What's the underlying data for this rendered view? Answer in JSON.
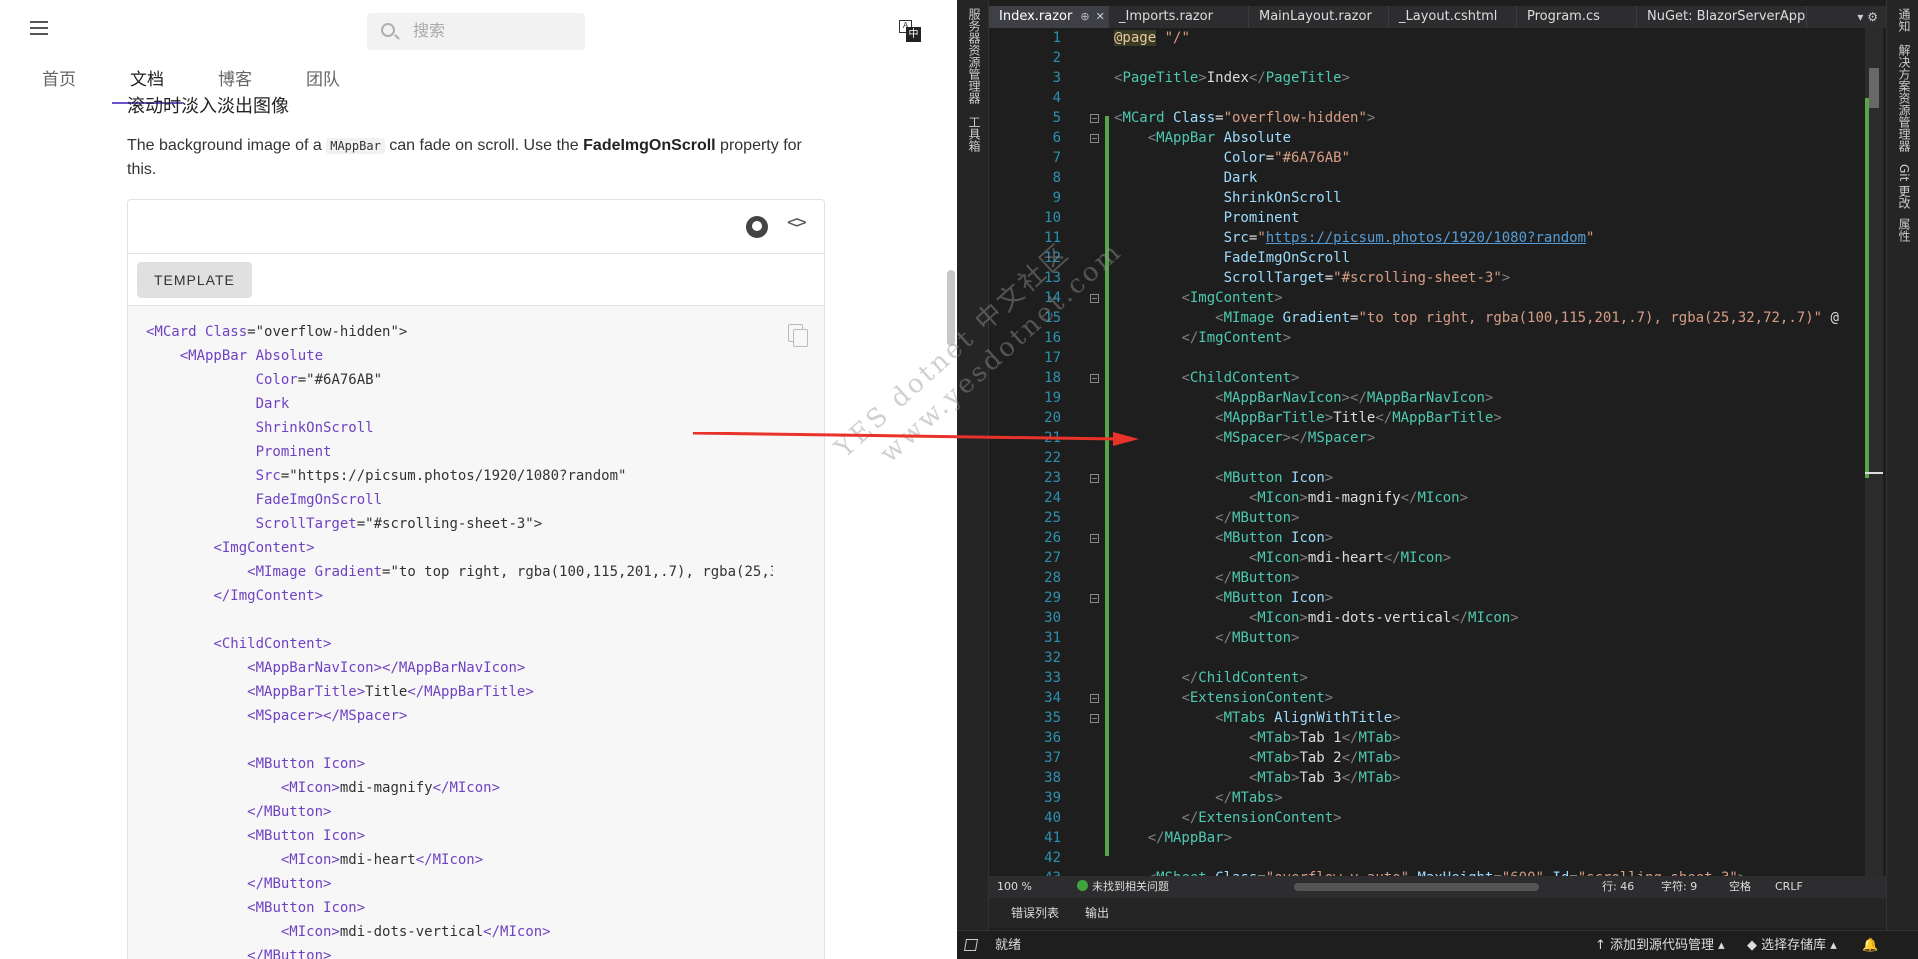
{
  "web": {
    "search_placeholder": "搜索",
    "translate_a": "A",
    "translate_zh": "中",
    "nav": [
      "首页",
      "文档",
      "博客",
      "团队"
    ],
    "section_title": "滚动时淡入淡出图像",
    "desc_pre": "The background image of a ",
    "desc_code": "MAppBar",
    "desc_mid": " can fade on scroll. Use the ",
    "desc_bold": "FadeImgOnScroll",
    "desc_post": " property for this.",
    "template_button": "TEMPLATE",
    "code_lines": [
      [
        [
          "t",
          "<MCard "
        ],
        [
          "a",
          "Class"
        ],
        [
          "x",
          "=\"overflow-hidden\">"
        ]
      ],
      [
        [
          "x",
          "    "
        ],
        [
          "t",
          "<MAppBar "
        ],
        [
          "a",
          "Absolute"
        ]
      ],
      [
        [
          "x",
          "             "
        ],
        [
          "a",
          "Color"
        ],
        [
          "x",
          "=\"#6A76AB\""
        ]
      ],
      [
        [
          "x",
          "             "
        ],
        [
          "a",
          "Dark"
        ]
      ],
      [
        [
          "x",
          "             "
        ],
        [
          "a",
          "ShrinkOnScroll"
        ]
      ],
      [
        [
          "x",
          "             "
        ],
        [
          "a",
          "Prominent"
        ]
      ],
      [
        [
          "x",
          "             "
        ],
        [
          "a",
          "Src"
        ],
        [
          "x",
          "=\"https://picsum.photos/1920/1080?random\""
        ]
      ],
      [
        [
          "x",
          "             "
        ],
        [
          "a",
          "FadeImgOnScroll"
        ]
      ],
      [
        [
          "x",
          "             "
        ],
        [
          "a",
          "ScrollTarget"
        ],
        [
          "x",
          "=\"#scrolling-sheet-3\">"
        ]
      ],
      [
        [
          "x",
          "        "
        ],
        [
          "t",
          "<ImgContent>"
        ]
      ],
      [
        [
          "x",
          "            "
        ],
        [
          "t",
          "<MImage "
        ],
        [
          "a",
          "Gradient"
        ],
        [
          "x",
          "=\"to top right, rgba(100,115,201,.7), rgba(25,32,72,.7)\""
        ]
      ],
      [
        [
          "x",
          "        "
        ],
        [
          "t",
          "</ImgContent>"
        ]
      ],
      [
        [
          "x",
          ""
        ]
      ],
      [
        [
          "x",
          "        "
        ],
        [
          "t",
          "<ChildContent>"
        ]
      ],
      [
        [
          "x",
          "            "
        ],
        [
          "t",
          "<MAppBarNavIcon></MAppBarNavIcon>"
        ]
      ],
      [
        [
          "x",
          "            "
        ],
        [
          "t",
          "<MAppBarTitle>"
        ],
        [
          "x",
          "Title"
        ],
        [
          "t",
          "</MAppBarTitle>"
        ]
      ],
      [
        [
          "x",
          "            "
        ],
        [
          "t",
          "<MSpacer></MSpacer>"
        ]
      ],
      [
        [
          "x",
          ""
        ]
      ],
      [
        [
          "x",
          "            "
        ],
        [
          "t",
          "<MButton "
        ],
        [
          "a",
          "Icon"
        ],
        [
          "t",
          ">"
        ]
      ],
      [
        [
          "x",
          "                "
        ],
        [
          "t",
          "<MIcon>"
        ],
        [
          "x",
          "mdi-magnify"
        ],
        [
          "t",
          "</MIcon>"
        ]
      ],
      [
        [
          "x",
          "            "
        ],
        [
          "t",
          "</MButton>"
        ]
      ],
      [
        [
          "x",
          "            "
        ],
        [
          "t",
          "<MButton "
        ],
        [
          "a",
          "Icon"
        ],
        [
          "t",
          ">"
        ]
      ],
      [
        [
          "x",
          "                "
        ],
        [
          "t",
          "<MIcon>"
        ],
        [
          "x",
          "mdi-heart"
        ],
        [
          "t",
          "</MIcon>"
        ]
      ],
      [
        [
          "x",
          "            "
        ],
        [
          "t",
          "</MButton>"
        ]
      ],
      [
        [
          "x",
          "            "
        ],
        [
          "t",
          "<MButton "
        ],
        [
          "a",
          "Icon"
        ],
        [
          "t",
          ">"
        ]
      ],
      [
        [
          "x",
          "                "
        ],
        [
          "t",
          "<MIcon>"
        ],
        [
          "x",
          "mdi-dots-vertical"
        ],
        [
          "t",
          "</MIcon>"
        ]
      ],
      [
        [
          "x",
          "            "
        ],
        [
          "t",
          "</MButton>"
        ]
      ]
    ]
  },
  "watermark": [
    "YES  dotnet 中文社区",
    "www.yesdotnet.com"
  ],
  "ide": {
    "left_tools": [
      "服务器资源管理器",
      "工具箱"
    ],
    "right_tools": [
      "通知",
      "解决方案资源管理器",
      "Git 更改",
      "属性"
    ],
    "tabs": [
      "Index.razor",
      "_Imports.razor",
      "MainLayout.razor",
      "_Layout.cshtml",
      "Program.cs",
      "NuGet: BlazorServerApp"
    ],
    "tab_pin": "⊕",
    "tab_close": "✕",
    "tab_controls": "▾  ⚙",
    "zoom": "100 %",
    "issues": "未找到相关问题",
    "row": "行: 46",
    "col": "字符: 9",
    "space": "空格",
    "eol": "CRLF",
    "output_tabs": [
      "错误列表",
      "输出"
    ],
    "status_ready": "就绪",
    "status_source": "↑ 添加到源代码管理 ▴",
    "status_repo": "◆ 选择存储库 ▴",
    "status_bell": "🔔",
    "code_lines": [
      [
        [
          "r",
          "@page"
        ],
        [
          "w",
          " "
        ],
        [
          "s",
          "\"/\""
        ]
      ],
      [
        [
          "w",
          ""
        ]
      ],
      [
        [
          "b",
          "<"
        ],
        [
          "t",
          "PageTitle"
        ],
        [
          "b",
          ">"
        ],
        [
          "w",
          "Index"
        ],
        [
          "b",
          "</"
        ],
        [
          "t",
          "PageTitle"
        ],
        [
          "b",
          ">"
        ]
      ],
      [
        [
          "w",
          ""
        ]
      ],
      [
        [
          "b",
          "<"
        ],
        [
          "t",
          "MCard "
        ],
        [
          "a",
          "Class"
        ],
        [
          "w",
          "="
        ],
        [
          "s",
          "\"overflow-hidden\""
        ],
        [
          "b",
          ">"
        ]
      ],
      [
        [
          "w",
          "    "
        ],
        [
          "b",
          "<"
        ],
        [
          "t",
          "MAppBar "
        ],
        [
          "a",
          "Absolute"
        ]
      ],
      [
        [
          "w",
          "             "
        ],
        [
          "a",
          "Color"
        ],
        [
          "w",
          "="
        ],
        [
          "s",
          "\"#6A76AB\""
        ]
      ],
      [
        [
          "w",
          "             "
        ],
        [
          "a",
          "Dark"
        ]
      ],
      [
        [
          "w",
          "             "
        ],
        [
          "a",
          "ShrinkOnScroll"
        ]
      ],
      [
        [
          "w",
          "             "
        ],
        [
          "a",
          "Prominent"
        ]
      ],
      [
        [
          "w",
          "             "
        ],
        [
          "a",
          "Src"
        ],
        [
          "w",
          "="
        ],
        [
          "s",
          "\""
        ],
        [
          "u",
          "https://picsum.photos/1920/1080?random"
        ],
        [
          "s",
          "\""
        ]
      ],
      [
        [
          "w",
          "             "
        ],
        [
          "a",
          "FadeImgOnScroll"
        ]
      ],
      [
        [
          "w",
          "             "
        ],
        [
          "a",
          "ScrollTarget"
        ],
        [
          "w",
          "="
        ],
        [
          "s",
          "\"#scrolling-sheet-3\""
        ],
        [
          "b",
          ">"
        ]
      ],
      [
        [
          "w",
          "        "
        ],
        [
          "b",
          "<"
        ],
        [
          "t",
          "ImgContent"
        ],
        [
          "b",
          ">"
        ]
      ],
      [
        [
          "w",
          "            "
        ],
        [
          "b",
          "<"
        ],
        [
          "t",
          "MImage "
        ],
        [
          "a",
          "Gradient"
        ],
        [
          "w",
          "="
        ],
        [
          "s",
          "\"to top right, rgba(100,115,201,.7), rgba(25,32,72,.7)\""
        ],
        [
          "w",
          " @"
        ]
      ],
      [
        [
          "w",
          "        "
        ],
        [
          "b",
          "</"
        ],
        [
          "t",
          "ImgContent"
        ],
        [
          "b",
          ">"
        ]
      ],
      [
        [
          "w",
          ""
        ]
      ],
      [
        [
          "w",
          "        "
        ],
        [
          "b",
          "<"
        ],
        [
          "t",
          "ChildContent"
        ],
        [
          "b",
          ">"
        ]
      ],
      [
        [
          "w",
          "            "
        ],
        [
          "b",
          "<"
        ],
        [
          "t",
          "MAppBarNavIcon"
        ],
        [
          "b",
          "></"
        ],
        [
          "t",
          "MAppBarNavIcon"
        ],
        [
          "b",
          ">"
        ]
      ],
      [
        [
          "w",
          "            "
        ],
        [
          "b",
          "<"
        ],
        [
          "t",
          "MAppBarTitle"
        ],
        [
          "b",
          ">"
        ],
        [
          "w",
          "Title"
        ],
        [
          "b",
          "</"
        ],
        [
          "t",
          "MAppBarTitle"
        ],
        [
          "b",
          ">"
        ]
      ],
      [
        [
          "w",
          "            "
        ],
        [
          "b",
          "<"
        ],
        [
          "t",
          "MSpacer"
        ],
        [
          "b",
          "></"
        ],
        [
          "t",
          "MSpacer"
        ],
        [
          "b",
          ">"
        ]
      ],
      [
        [
          "w",
          ""
        ]
      ],
      [
        [
          "w",
          "            "
        ],
        [
          "b",
          "<"
        ],
        [
          "t",
          "MButton "
        ],
        [
          "a",
          "Icon"
        ],
        [
          "b",
          ">"
        ]
      ],
      [
        [
          "w",
          "                "
        ],
        [
          "b",
          "<"
        ],
        [
          "t",
          "MIcon"
        ],
        [
          "b",
          ">"
        ],
        [
          "w",
          "mdi-magnify"
        ],
        [
          "b",
          "</"
        ],
        [
          "t",
          "MIcon"
        ],
        [
          "b",
          ">"
        ]
      ],
      [
        [
          "w",
          "            "
        ],
        [
          "b",
          "</"
        ],
        [
          "t",
          "MButton"
        ],
        [
          "b",
          ">"
        ]
      ],
      [
        [
          "w",
          "            "
        ],
        [
          "b",
          "<"
        ],
        [
          "t",
          "MButton "
        ],
        [
          "a",
          "Icon"
        ],
        [
          "b",
          ">"
        ]
      ],
      [
        [
          "w",
          "                "
        ],
        [
          "b",
          "<"
        ],
        [
          "t",
          "MIcon"
        ],
        [
          "b",
          ">"
        ],
        [
          "w",
          "mdi-heart"
        ],
        [
          "b",
          "</"
        ],
        [
          "t",
          "MIcon"
        ],
        [
          "b",
          ">"
        ]
      ],
      [
        [
          "w",
          "            "
        ],
        [
          "b",
          "</"
        ],
        [
          "t",
          "MButton"
        ],
        [
          "b",
          ">"
        ]
      ],
      [
        [
          "w",
          "            "
        ],
        [
          "b",
          "<"
        ],
        [
          "t",
          "MButton "
        ],
        [
          "a",
          "Icon"
        ],
        [
          "b",
          ">"
        ]
      ],
      [
        [
          "w",
          "                "
        ],
        [
          "b",
          "<"
        ],
        [
          "t",
          "MIcon"
        ],
        [
          "b",
          ">"
        ],
        [
          "w",
          "mdi-dots-vertical"
        ],
        [
          "b",
          "</"
        ],
        [
          "t",
          "MIcon"
        ],
        [
          "b",
          ">"
        ]
      ],
      [
        [
          "w",
          "            "
        ],
        [
          "b",
          "</"
        ],
        [
          "t",
          "MButton"
        ],
        [
          "b",
          ">"
        ]
      ],
      [
        [
          "w",
          ""
        ]
      ],
      [
        [
          "w",
          "        "
        ],
        [
          "b",
          "</"
        ],
        [
          "t",
          "ChildContent"
        ],
        [
          "b",
          ">"
        ]
      ],
      [
        [
          "w",
          "        "
        ],
        [
          "b",
          "<"
        ],
        [
          "t",
          "ExtensionContent"
        ],
        [
          "b",
          ">"
        ]
      ],
      [
        [
          "w",
          "            "
        ],
        [
          "b",
          "<"
        ],
        [
          "t",
          "MTabs "
        ],
        [
          "a",
          "AlignWithTitle"
        ],
        [
          "b",
          ">"
        ]
      ],
      [
        [
          "w",
          "                "
        ],
        [
          "b",
          "<"
        ],
        [
          "t",
          "MTab"
        ],
        [
          "b",
          ">"
        ],
        [
          "w",
          "Tab 1"
        ],
        [
          "b",
          "</"
        ],
        [
          "t",
          "MTab"
        ],
        [
          "b",
          ">"
        ]
      ],
      [
        [
          "w",
          "                "
        ],
        [
          "b",
          "<"
        ],
        [
          "t",
          "MTab"
        ],
        [
          "b",
          ">"
        ],
        [
          "w",
          "Tab 2"
        ],
        [
          "b",
          "</"
        ],
        [
          "t",
          "MTab"
        ],
        [
          "b",
          ">"
        ]
      ],
      [
        [
          "w",
          "                "
        ],
        [
          "b",
          "<"
        ],
        [
          "t",
          "MTab"
        ],
        [
          "b",
          ">"
        ],
        [
          "w",
          "Tab 3"
        ],
        [
          "b",
          "</"
        ],
        [
          "t",
          "MTab"
        ],
        [
          "b",
          ">"
        ]
      ],
      [
        [
          "w",
          "            "
        ],
        [
          "b",
          "</"
        ],
        [
          "t",
          "MTabs"
        ],
        [
          "b",
          ">"
        ]
      ],
      [
        [
          "w",
          "        "
        ],
        [
          "b",
          "</"
        ],
        [
          "t",
          "ExtensionContent"
        ],
        [
          "b",
          ">"
        ]
      ],
      [
        [
          "w",
          "    "
        ],
        [
          "b",
          "</"
        ],
        [
          "t",
          "MAppBar"
        ],
        [
          "b",
          ">"
        ]
      ],
      [
        [
          "w",
          ""
        ]
      ],
      [
        [
          "w",
          "    "
        ],
        [
          "b",
          "<"
        ],
        [
          "t",
          "MSheet "
        ],
        [
          "a",
          "Class"
        ],
        [
          "w",
          "="
        ],
        [
          "s",
          "\"overflow-y-auto\""
        ],
        [
          "w",
          " "
        ],
        [
          "a",
          "MaxHeight"
        ],
        [
          "w",
          "="
        ],
        [
          "s",
          "\"600\""
        ],
        [
          "w",
          " "
        ],
        [
          "a",
          "Id"
        ],
        [
          "w",
          "="
        ],
        [
          "s",
          "\"scrolling-sheet-3\""
        ],
        [
          "b",
          ">"
        ]
      ]
    ],
    "fold_lines": [
      5,
      6,
      14,
      18,
      23,
      26,
      29,
      34,
      35
    ]
  }
}
